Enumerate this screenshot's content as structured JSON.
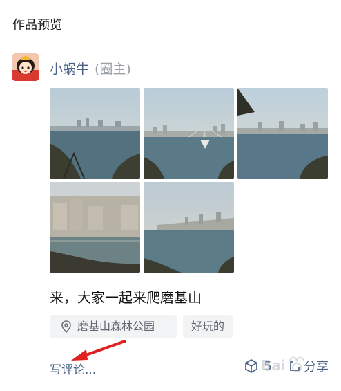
{
  "page": {
    "title": "作品预览"
  },
  "post": {
    "author_name": "小蜗牛",
    "author_role": "(圈主)",
    "text": "来，大家一起来爬磨基山",
    "tags": [
      "磨基山森林公园",
      "好玩的"
    ],
    "comment_placeholder": "写评论...",
    "like_count": "5",
    "share_label": "分享",
    "photo_count": 5
  },
  "icons": {
    "location": "location-pin-icon",
    "like": "cube-like-icon",
    "share": "share-icon"
  },
  "colors": {
    "accent_text": "#4a6285",
    "tag_bg": "#f2f3f5",
    "arrow": "#e02020"
  }
}
